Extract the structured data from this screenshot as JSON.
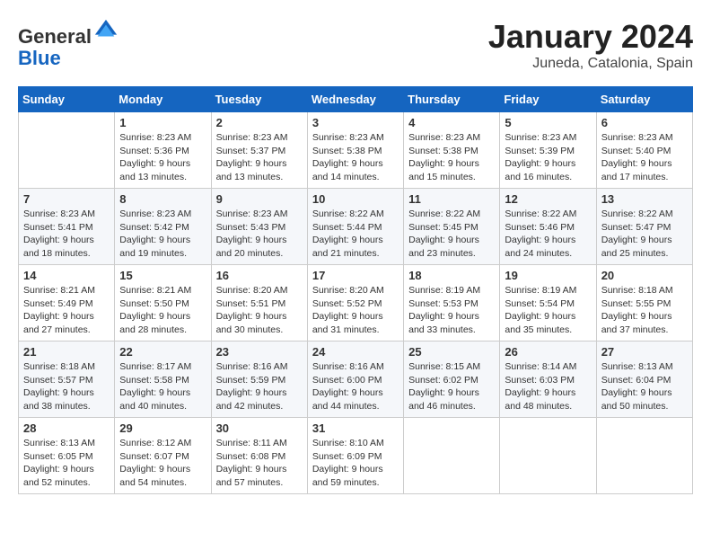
{
  "logo": {
    "general": "General",
    "blue": "Blue"
  },
  "title": "January 2024",
  "subtitle": "Juneda, Catalonia, Spain",
  "days_header": [
    "Sunday",
    "Monday",
    "Tuesday",
    "Wednesday",
    "Thursday",
    "Friday",
    "Saturday"
  ],
  "weeks": [
    [
      {
        "day": "",
        "info": ""
      },
      {
        "day": "1",
        "info": "Sunrise: 8:23 AM\nSunset: 5:36 PM\nDaylight: 9 hours\nand 13 minutes."
      },
      {
        "day": "2",
        "info": "Sunrise: 8:23 AM\nSunset: 5:37 PM\nDaylight: 9 hours\nand 13 minutes."
      },
      {
        "day": "3",
        "info": "Sunrise: 8:23 AM\nSunset: 5:38 PM\nDaylight: 9 hours\nand 14 minutes."
      },
      {
        "day": "4",
        "info": "Sunrise: 8:23 AM\nSunset: 5:38 PM\nDaylight: 9 hours\nand 15 minutes."
      },
      {
        "day": "5",
        "info": "Sunrise: 8:23 AM\nSunset: 5:39 PM\nDaylight: 9 hours\nand 16 minutes."
      },
      {
        "day": "6",
        "info": "Sunrise: 8:23 AM\nSunset: 5:40 PM\nDaylight: 9 hours\nand 17 minutes."
      }
    ],
    [
      {
        "day": "7",
        "info": "Sunrise: 8:23 AM\nSunset: 5:41 PM\nDaylight: 9 hours\nand 18 minutes."
      },
      {
        "day": "8",
        "info": "Sunrise: 8:23 AM\nSunset: 5:42 PM\nDaylight: 9 hours\nand 19 minutes."
      },
      {
        "day": "9",
        "info": "Sunrise: 8:23 AM\nSunset: 5:43 PM\nDaylight: 9 hours\nand 20 minutes."
      },
      {
        "day": "10",
        "info": "Sunrise: 8:22 AM\nSunset: 5:44 PM\nDaylight: 9 hours\nand 21 minutes."
      },
      {
        "day": "11",
        "info": "Sunrise: 8:22 AM\nSunset: 5:45 PM\nDaylight: 9 hours\nand 23 minutes."
      },
      {
        "day": "12",
        "info": "Sunrise: 8:22 AM\nSunset: 5:46 PM\nDaylight: 9 hours\nand 24 minutes."
      },
      {
        "day": "13",
        "info": "Sunrise: 8:22 AM\nSunset: 5:47 PM\nDaylight: 9 hours\nand 25 minutes."
      }
    ],
    [
      {
        "day": "14",
        "info": "Sunrise: 8:21 AM\nSunset: 5:49 PM\nDaylight: 9 hours\nand 27 minutes."
      },
      {
        "day": "15",
        "info": "Sunrise: 8:21 AM\nSunset: 5:50 PM\nDaylight: 9 hours\nand 28 minutes."
      },
      {
        "day": "16",
        "info": "Sunrise: 8:20 AM\nSunset: 5:51 PM\nDaylight: 9 hours\nand 30 minutes."
      },
      {
        "day": "17",
        "info": "Sunrise: 8:20 AM\nSunset: 5:52 PM\nDaylight: 9 hours\nand 31 minutes."
      },
      {
        "day": "18",
        "info": "Sunrise: 8:19 AM\nSunset: 5:53 PM\nDaylight: 9 hours\nand 33 minutes."
      },
      {
        "day": "19",
        "info": "Sunrise: 8:19 AM\nSunset: 5:54 PM\nDaylight: 9 hours\nand 35 minutes."
      },
      {
        "day": "20",
        "info": "Sunrise: 8:18 AM\nSunset: 5:55 PM\nDaylight: 9 hours\nand 37 minutes."
      }
    ],
    [
      {
        "day": "21",
        "info": "Sunrise: 8:18 AM\nSunset: 5:57 PM\nDaylight: 9 hours\nand 38 minutes."
      },
      {
        "day": "22",
        "info": "Sunrise: 8:17 AM\nSunset: 5:58 PM\nDaylight: 9 hours\nand 40 minutes."
      },
      {
        "day": "23",
        "info": "Sunrise: 8:16 AM\nSunset: 5:59 PM\nDaylight: 9 hours\nand 42 minutes."
      },
      {
        "day": "24",
        "info": "Sunrise: 8:16 AM\nSunset: 6:00 PM\nDaylight: 9 hours\nand 44 minutes."
      },
      {
        "day": "25",
        "info": "Sunrise: 8:15 AM\nSunset: 6:02 PM\nDaylight: 9 hours\nand 46 minutes."
      },
      {
        "day": "26",
        "info": "Sunrise: 8:14 AM\nSunset: 6:03 PM\nDaylight: 9 hours\nand 48 minutes."
      },
      {
        "day": "27",
        "info": "Sunrise: 8:13 AM\nSunset: 6:04 PM\nDaylight: 9 hours\nand 50 minutes."
      }
    ],
    [
      {
        "day": "28",
        "info": "Sunrise: 8:13 AM\nSunset: 6:05 PM\nDaylight: 9 hours\nand 52 minutes."
      },
      {
        "day": "29",
        "info": "Sunrise: 8:12 AM\nSunset: 6:07 PM\nDaylight: 9 hours\nand 54 minutes."
      },
      {
        "day": "30",
        "info": "Sunrise: 8:11 AM\nSunset: 6:08 PM\nDaylight: 9 hours\nand 57 minutes."
      },
      {
        "day": "31",
        "info": "Sunrise: 8:10 AM\nSunset: 6:09 PM\nDaylight: 9 hours\nand 59 minutes."
      },
      {
        "day": "",
        "info": ""
      },
      {
        "day": "",
        "info": ""
      },
      {
        "day": "",
        "info": ""
      }
    ]
  ]
}
